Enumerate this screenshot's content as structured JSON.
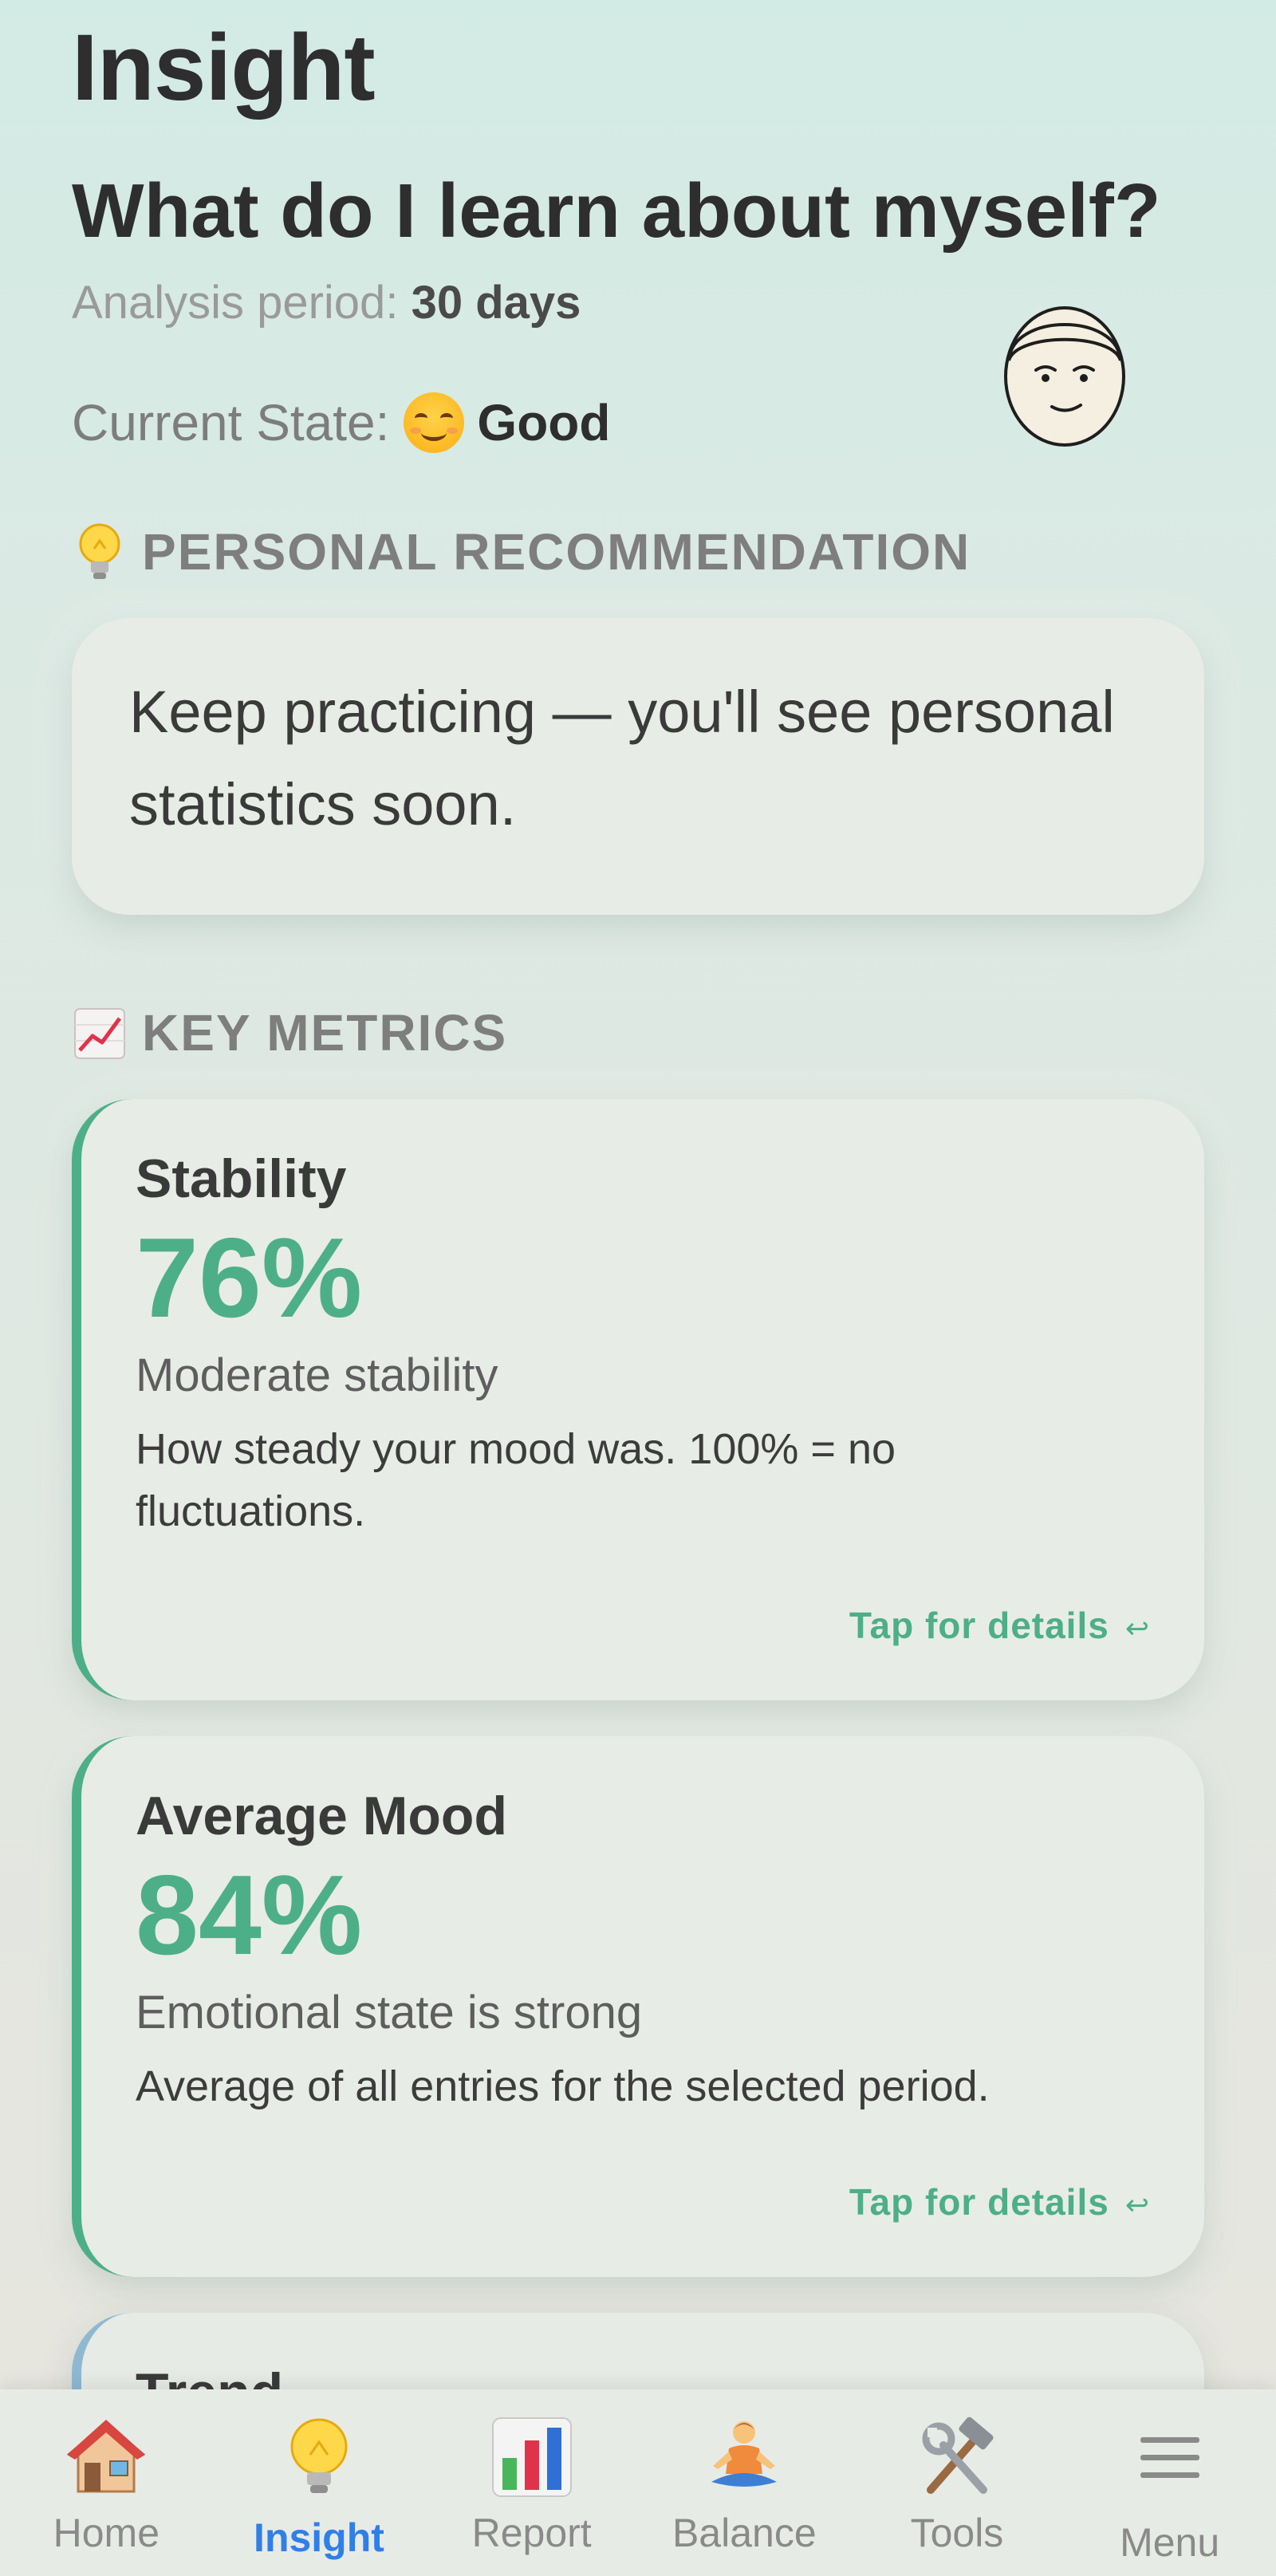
{
  "header": {
    "title": "Insight",
    "question": "What do I learn about myself?",
    "period_label": "Analysis period:",
    "period_value": "30 days",
    "state_label": "Current State:",
    "state_value": "Good",
    "state_icon": "smiling-face-emoji",
    "avatar_icon": "calm-face-avatar"
  },
  "recommendation": {
    "heading": "PERSONAL RECOMMENDATION",
    "heading_icon": "lightbulb-icon",
    "text": "Keep practicing — you'll see personal statistics soon."
  },
  "metrics": {
    "heading": "KEY METRICS",
    "heading_icon": "chart-increasing-icon",
    "accent_color": "#4daf87",
    "items": [
      {
        "title": "Stability",
        "value": "76%",
        "subtitle": "Moderate stability",
        "description": "How steady your mood was. 100% = no fluctuations.",
        "action": "Tap for details",
        "action_icon": "↩"
      },
      {
        "title": "Average Mood",
        "value": "84%",
        "subtitle": "Emotional state is strong",
        "description": "Average of all entries for the selected period.",
        "action": "Tap for details",
        "action_icon": "↩"
      },
      {
        "title": "Trend"
      }
    ]
  },
  "nav": {
    "active_color": "#2f7fe8",
    "items": [
      {
        "label": "Home",
        "icon": "house-icon"
      },
      {
        "label": "Insight",
        "icon": "lightbulb-icon",
        "active": true
      },
      {
        "label": "Report",
        "icon": "bar-chart-icon"
      },
      {
        "label": "Balance",
        "icon": "meditation-icon"
      },
      {
        "label": "Tools",
        "icon": "hammer-wrench-icon"
      },
      {
        "label": "Menu",
        "icon": "hamburger-menu-icon"
      }
    ]
  }
}
